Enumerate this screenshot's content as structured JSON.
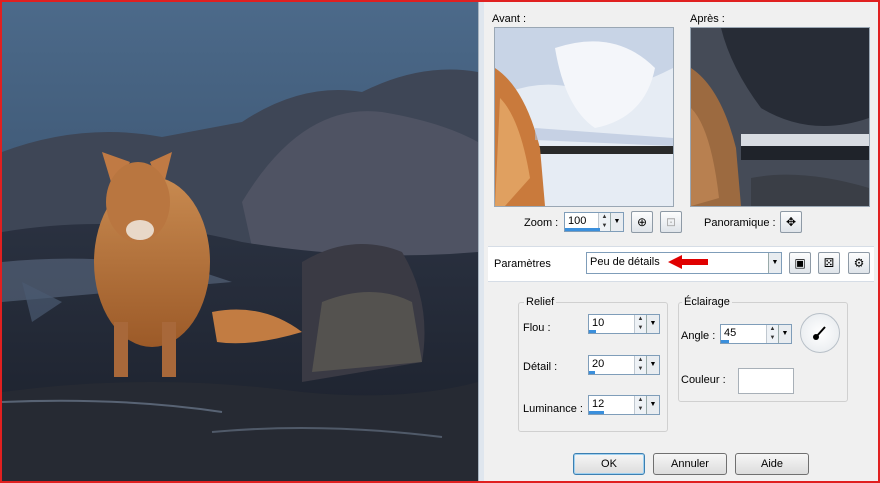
{
  "labels": {
    "avant": "Avant :",
    "apres": "Après :",
    "zoom": "Zoom :",
    "panoramique": "Panoramique :",
    "parametres": "Paramètres",
    "relief": "Relief",
    "eclairage": "Éclairage",
    "flou": "Flou :",
    "detail": "Détail :",
    "luminance": "Luminance :",
    "angle": "Angle :",
    "couleur": "Couleur :"
  },
  "zoom": {
    "value": "100",
    "level": 0.5
  },
  "preset": {
    "value": "Peu de détails"
  },
  "relief": {
    "flou": {
      "value": "10",
      "level": 0.1
    },
    "detail": {
      "value": "20",
      "level": 0.2
    },
    "luminance": {
      "value": "12",
      "level": 0.3
    }
  },
  "eclairage": {
    "angle": {
      "value": "45",
      "level": 0.12
    },
    "couleur": "#ffffff"
  },
  "buttons": {
    "ok": "OK",
    "annuler": "Annuler",
    "aide": "Aide"
  },
  "colors": {
    "accent": "#3a8fdc",
    "arrow": "#e00000",
    "frame": "#e02020"
  }
}
